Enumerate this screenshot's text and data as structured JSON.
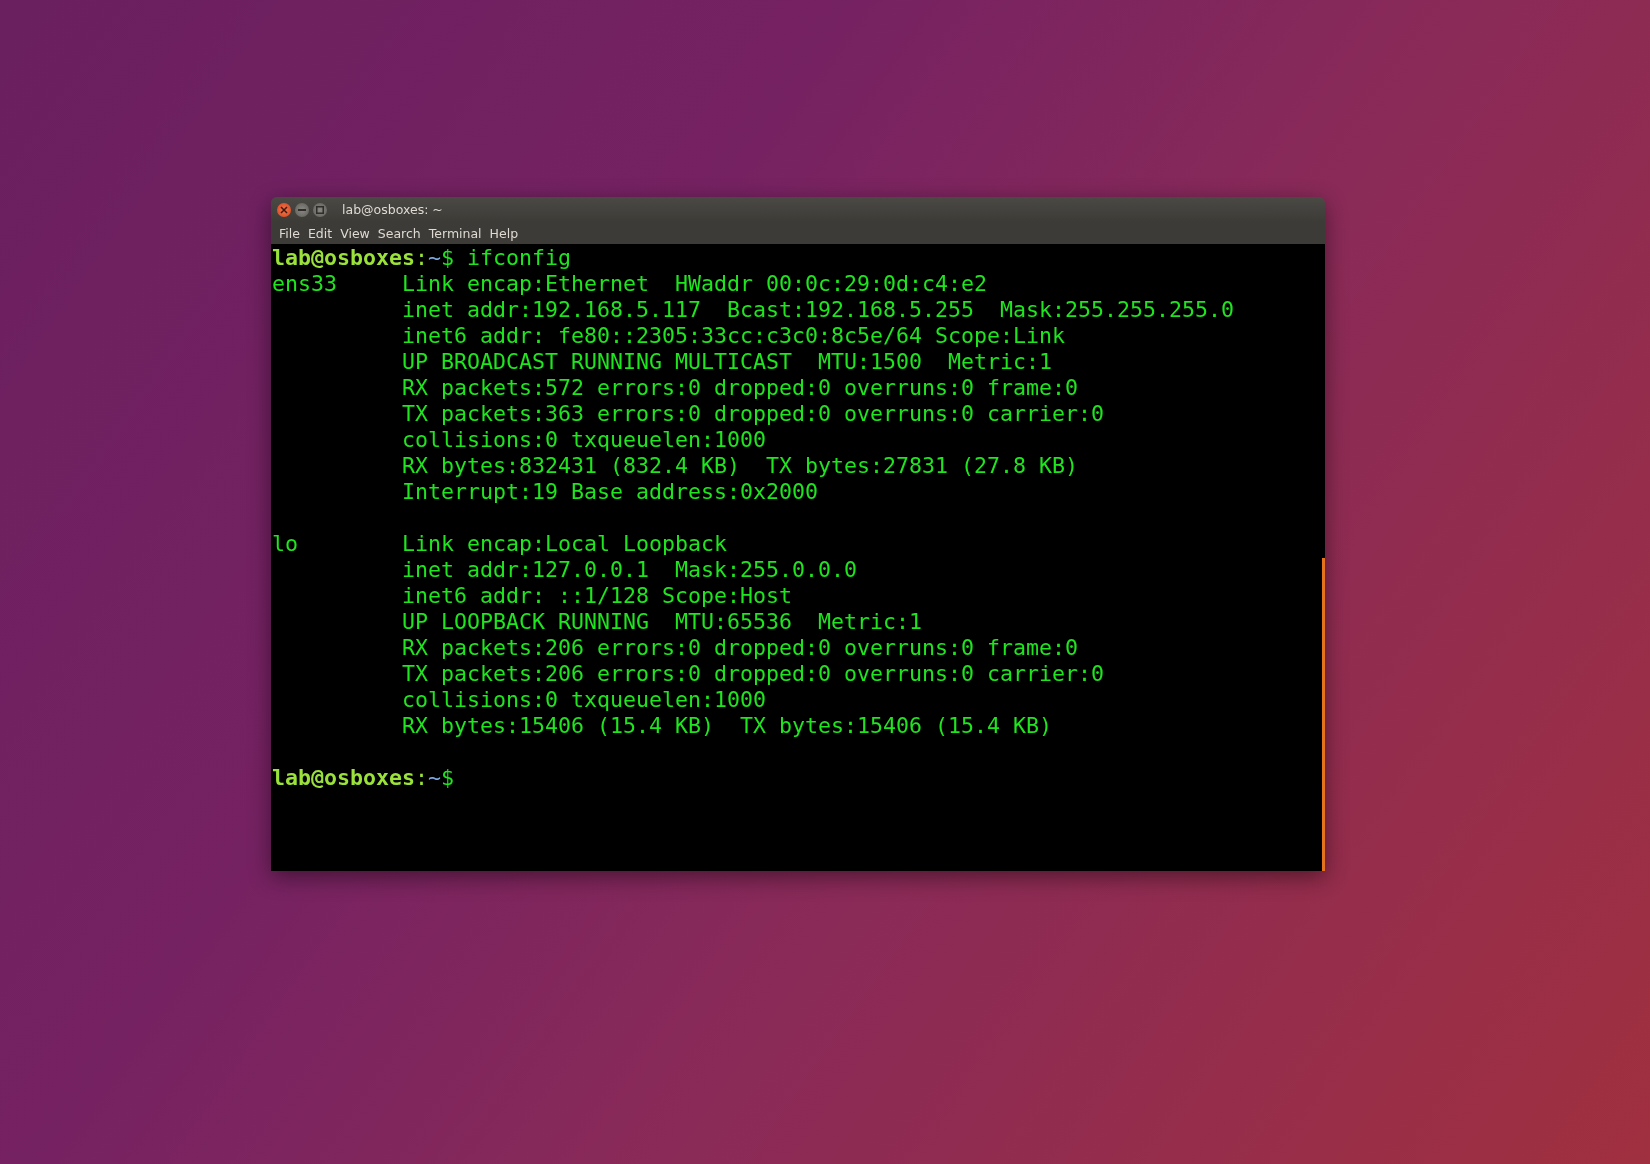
{
  "window": {
    "title": "lab@osboxes: ~"
  },
  "menu": [
    {
      "label": "File"
    },
    {
      "label": "Edit"
    },
    {
      "label": "View"
    },
    {
      "label": "Search"
    },
    {
      "label": "Terminal"
    },
    {
      "label": "Help"
    }
  ],
  "terminal": {
    "lines": [
      {
        "kind": "prompt",
        "user_host": "lab@osboxes",
        "separator": ":",
        "path": "~",
        "symbol": "$",
        "command": "ifconfig"
      },
      {
        "kind": "output",
        "iface": "ens33",
        "text": "Link encap:Ethernet  HWaddr 00:0c:29:0d:c4:e2"
      },
      {
        "kind": "output",
        "text": "inet addr:192.168.5.117  Bcast:192.168.5.255  Mask:255.255.255.0"
      },
      {
        "kind": "output",
        "text": "inet6 addr: fe80::2305:33cc:c3c0:8c5e/64 Scope:Link"
      },
      {
        "kind": "output",
        "text": "UP BROADCAST RUNNING MULTICAST  MTU:1500  Metric:1"
      },
      {
        "kind": "output",
        "text": "RX packets:572 errors:0 dropped:0 overruns:0 frame:0"
      },
      {
        "kind": "output",
        "text": "TX packets:363 errors:0 dropped:0 overruns:0 carrier:0"
      },
      {
        "kind": "output",
        "text": "collisions:0 txqueuelen:1000"
      },
      {
        "kind": "output",
        "text": "RX bytes:832431 (832.4 KB)  TX bytes:27831 (27.8 KB)"
      },
      {
        "kind": "output",
        "text": "Interrupt:19 Base address:0x2000"
      },
      {
        "kind": "blank"
      },
      {
        "kind": "output",
        "iface": "lo",
        "text": "Link encap:Local Loopback"
      },
      {
        "kind": "output",
        "text": "inet addr:127.0.0.1  Mask:255.0.0.0"
      },
      {
        "kind": "output",
        "text": "inet6 addr: ::1/128 Scope:Host"
      },
      {
        "kind": "output",
        "text": "UP LOOPBACK RUNNING  MTU:65536  Metric:1"
      },
      {
        "kind": "output",
        "text": "RX packets:206 errors:0 dropped:0 overruns:0 frame:0"
      },
      {
        "kind": "output",
        "text": "TX packets:206 errors:0 dropped:0 overruns:0 carrier:0"
      },
      {
        "kind": "output",
        "text": "collisions:0 txqueuelen:1000"
      },
      {
        "kind": "output",
        "text": "RX bytes:15406 (15.4 KB)  TX bytes:15406 (15.4 KB)"
      },
      {
        "kind": "blank"
      },
      {
        "kind": "prompt",
        "user_host": "lab@osboxes",
        "separator": ":",
        "path": "~",
        "symbol": "$"
      }
    ]
  }
}
